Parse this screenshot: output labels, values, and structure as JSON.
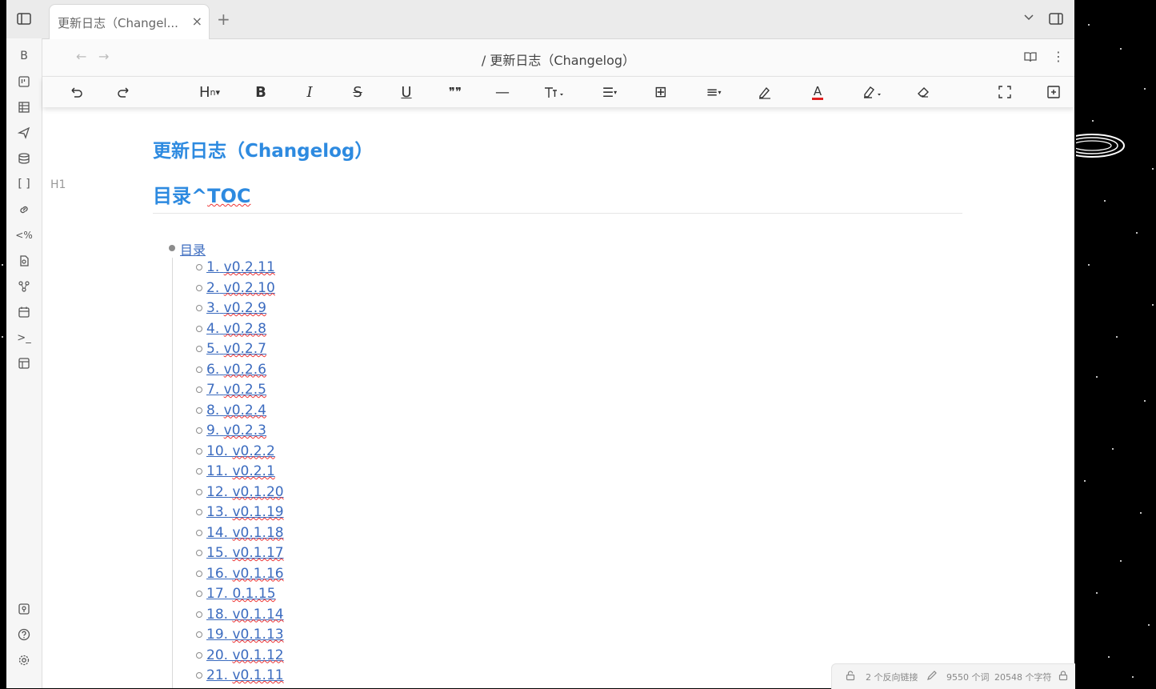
{
  "tabs": [
    {
      "title": "更新日志（Changel...",
      "close": "×"
    }
  ],
  "tabbar": {
    "new_tab": "+"
  },
  "nav": {
    "back": "←",
    "forward": "→",
    "breadcrumb": "/ 更新日志（Changelog）",
    "more": "⋮"
  },
  "ribbon_top": [
    {
      "name": "bold-b-icon",
      "glyph": "B"
    },
    {
      "name": "kanban-icon",
      "glyph": ""
    },
    {
      "name": "table-icon",
      "glyph": ""
    },
    {
      "name": "send-icon",
      "glyph": ""
    },
    {
      "name": "database-icon",
      "glyph": ""
    },
    {
      "name": "brackets-icon",
      "glyph": "[ ]"
    },
    {
      "name": "link-icon",
      "glyph": ""
    },
    {
      "name": "template-percent-icon",
      "glyph": "<%"
    },
    {
      "name": "file-search-icon",
      "glyph": ""
    },
    {
      "name": "graph-icon",
      "glyph": ""
    },
    {
      "name": "calendar-icon",
      "glyph": ""
    },
    {
      "name": "terminal-icon",
      "glyph": ">_"
    },
    {
      "name": "layout-icon",
      "glyph": ""
    }
  ],
  "ribbon_bottom": [
    {
      "name": "vault-icon"
    },
    {
      "name": "help-icon"
    },
    {
      "name": "settings-icon"
    }
  ],
  "toolbar": {
    "heading": "H",
    "bold": "B",
    "italic": "I",
    "strike": "S",
    "underline": "U",
    "quote": "❞❞",
    "divider": "—",
    "list": "☰",
    "table": "⊞",
    "align": "≡",
    "font_color_letter": "A",
    "font_color": "#e02020"
  },
  "document": {
    "title": "更新日志（Changelog）",
    "heading_marker": "H1",
    "toc_heading_prefix": "目录^",
    "toc_heading_suffix": "TOC",
    "toc_root": "目录",
    "toc_items": [
      {
        "num": "1.",
        "ver": "v0.2.11"
      },
      {
        "num": "2.",
        "ver": "v0.2.10"
      },
      {
        "num": "3.",
        "ver": "v0.2.9"
      },
      {
        "num": "4.",
        "ver": "v0.2.8"
      },
      {
        "num": "5.",
        "ver": "v0.2.7"
      },
      {
        "num": "6.",
        "ver": "v0.2.6"
      },
      {
        "num": "7.",
        "ver": "v0.2.5"
      },
      {
        "num": "8.",
        "ver": "v0.2.4"
      },
      {
        "num": "9.",
        "ver": "v0.2.3"
      },
      {
        "num": "10.",
        "ver": "v0.2.2"
      },
      {
        "num": "11.",
        "ver": "v0.2.1"
      },
      {
        "num": "12.",
        "ver": "v0.1.20"
      },
      {
        "num": "13.",
        "ver": "v0.1.19"
      },
      {
        "num": "14.",
        "ver": "v0.1.18"
      },
      {
        "num": "15.",
        "ver": "v0.1.17"
      },
      {
        "num": "16.",
        "ver": "v0.1.16"
      },
      {
        "num": "17.",
        "ver": "0.1.15"
      },
      {
        "num": "18.",
        "ver": "v0.1.14"
      },
      {
        "num": "19.",
        "ver": "v0.1.13"
      },
      {
        "num": "20.",
        "ver": "v0.1.12"
      },
      {
        "num": "21.",
        "ver": "v0.1.11"
      }
    ]
  },
  "status": {
    "backlinks": "2 个反向链接",
    "words": "9550 个词",
    "chars": "20548 个字符"
  },
  "colors": {
    "heading": "#2d8ae0",
    "link": "#3b6bbf"
  }
}
